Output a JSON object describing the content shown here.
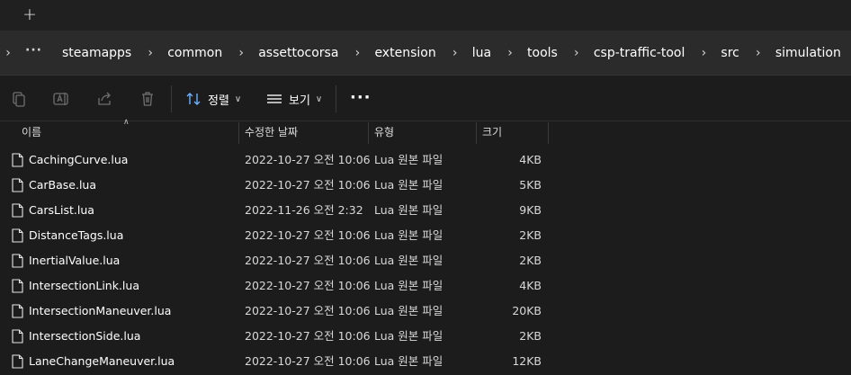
{
  "tabbar": {
    "new_tab_glyph": "+"
  },
  "address": {
    "overflow": "···",
    "crumbs": [
      "steamapps",
      "common",
      "assettocorsa",
      "extension",
      "lua",
      "tools",
      "csp-traffic-tool",
      "src",
      "simulation"
    ]
  },
  "toolbar": {
    "sort_label": "정렬",
    "view_label": "보기",
    "more_label": "···",
    "icons": [
      "copy-icon",
      "rename-icon",
      "share-icon",
      "delete-icon",
      "sort-icon",
      "view-icon",
      "more-icon"
    ]
  },
  "columns": {
    "name": "이름",
    "date": "수정한 날짜",
    "type": "유형",
    "size": "크기"
  },
  "files": [
    {
      "name": "CachingCurve.lua",
      "date": "2022-10-27 오전 10:06",
      "type": "Lua 원본 파일",
      "size": "4KB"
    },
    {
      "name": "CarBase.lua",
      "date": "2022-10-27 오전 10:06",
      "type": "Lua 원본 파일",
      "size": "5KB"
    },
    {
      "name": "CarsList.lua",
      "date": "2022-11-26 오전 2:32",
      "type": "Lua 원본 파일",
      "size": "9KB"
    },
    {
      "name": "DistanceTags.lua",
      "date": "2022-10-27 오전 10:06",
      "type": "Lua 원본 파일",
      "size": "2KB"
    },
    {
      "name": "InertialValue.lua",
      "date": "2022-10-27 오전 10:06",
      "type": "Lua 원본 파일",
      "size": "2KB"
    },
    {
      "name": "IntersectionLink.lua",
      "date": "2022-10-27 오전 10:06",
      "type": "Lua 원본 파일",
      "size": "4KB"
    },
    {
      "name": "IntersectionManeuver.lua",
      "date": "2022-10-27 오전 10:06",
      "type": "Lua 원본 파일",
      "size": "20KB"
    },
    {
      "name": "IntersectionSide.lua",
      "date": "2022-10-27 오전 10:06",
      "type": "Lua 원본 파일",
      "size": "2KB"
    },
    {
      "name": "LaneChangeManeuver.lua",
      "date": "2022-10-27 오전 10:06",
      "type": "Lua 원본 파일",
      "size": "12KB"
    }
  ]
}
